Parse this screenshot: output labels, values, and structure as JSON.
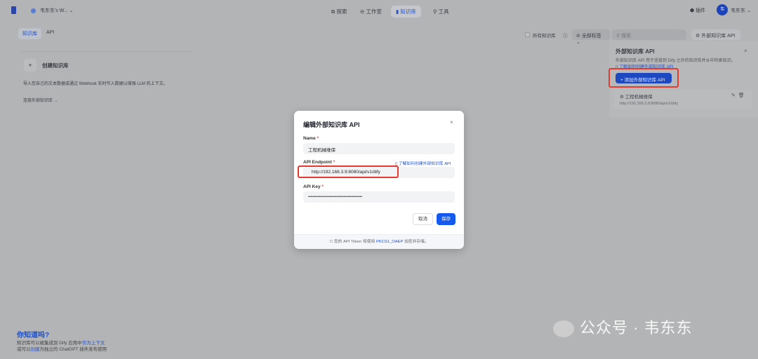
{
  "header": {
    "workspace": "韦东东's W...",
    "nav": [
      "探索",
      "工作室",
      "知识库",
      "工具"
    ],
    "active_nav": "知识库",
    "plugin": "插件",
    "avatar": "韦",
    "user": "韦东东"
  },
  "tabs": [
    "知识库",
    "API"
  ],
  "create": {
    "plus": "+",
    "label": "创建知识库",
    "desc": "导入您自己的文本数据或通过 Webhook 实时写入数据以增强 LLM 的上下文。",
    "connect": "连接外部知识库 →"
  },
  "filters": {
    "all_kb": "所有知识库",
    "tags": "全部标签",
    "search_placeholder": "搜索",
    "ext_api": "外部知识库 API"
  },
  "panel": {
    "title": "外部知识库 API",
    "desc": "外部知识库 API 用于连接到 Dify 之外的知识库并从中检索知识。",
    "link": "了解如何创建外部知识库 API",
    "add": "+ 添加外部知识库 API",
    "entry": {
      "name": "工程机械维保",
      "url": "http://192.168.3.9:8080/api/v1/dify"
    }
  },
  "tip": {
    "title": "你知道吗?",
    "line1_a": "知识库可以被集成到 Dify 应用中",
    "line1_b": "作为上下文",
    "line2_a": "或可以",
    "line2_b": "创建",
    "line2_c": "为独立的 ChatGPT 插件发布使用"
  },
  "modal": {
    "title": "编辑外部知识库 API",
    "close": "×",
    "name_label": "Name",
    "name_value": "工程机械维保",
    "endpoint_label": "API Endpoint",
    "endpoint_value": "http://192.168.3.9:8080/api/v1/dify",
    "endpoint_link": "了解如何创建外部知识库 API",
    "key_label": "API Key",
    "key_value": "••••••••••••••••••••••••••••••••••••••••••••",
    "required": "*",
    "cancel": "取消",
    "save": "保存",
    "footer_a": "您的 API Token 将使用",
    "footer_b": "PKCS1_OAEP",
    "footer_c": "加密并存储。"
  },
  "watermark": "公众号 · 韦东东",
  "colors": {
    "accent": "#155aef",
    "highlight": "#e53a2f"
  }
}
